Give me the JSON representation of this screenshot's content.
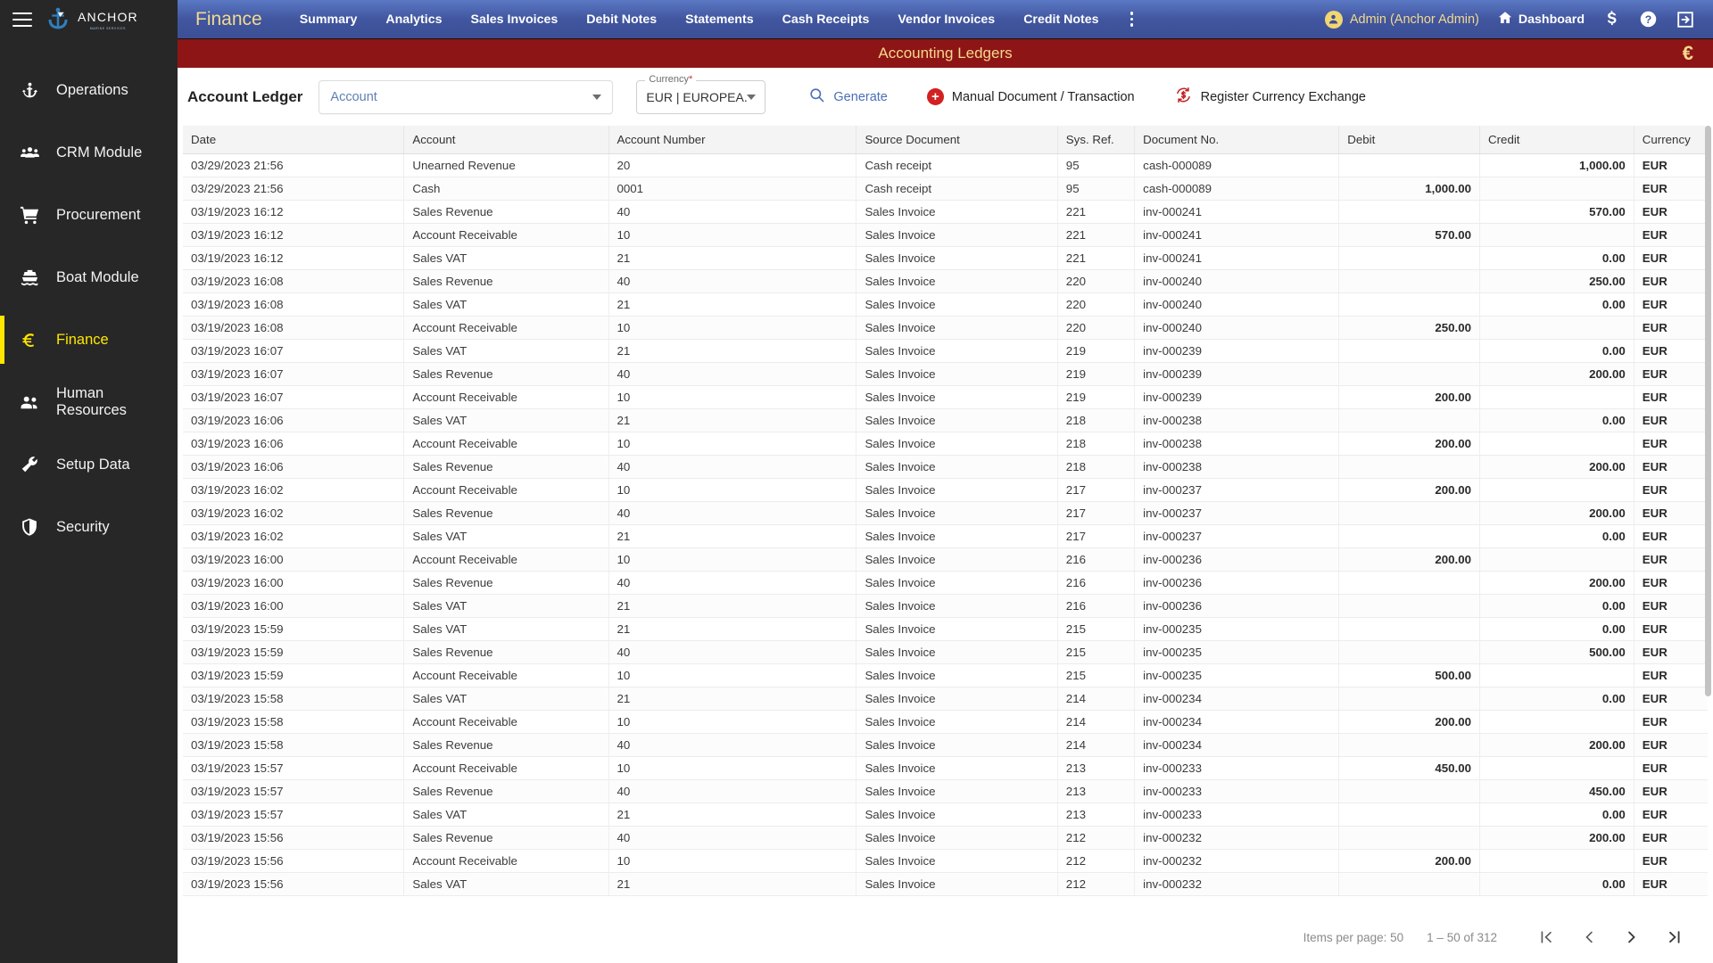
{
  "sidebar": {
    "logo": {
      "text": "ANCHOR",
      "sub": "MARINE SERVICES",
      "icon": "anchor-logo-icon"
    },
    "menu_icon": "hamburger-icon",
    "items": [
      {
        "label": "Operations",
        "icon": "anchor-icon",
        "active": false
      },
      {
        "label": "CRM Module",
        "icon": "people-icon",
        "active": false
      },
      {
        "label": "Procurement",
        "icon": "cart-icon",
        "active": false
      },
      {
        "label": "Boat Module",
        "icon": "boat-icon",
        "active": false
      },
      {
        "label": "Finance",
        "icon": "euro-icon",
        "active": true
      },
      {
        "label": "Human Resources",
        "icon": "group-icon",
        "active": false
      },
      {
        "label": "Setup Data",
        "icon": "wrench-icon",
        "active": false
      },
      {
        "label": "Security",
        "icon": "shield-icon",
        "active": false
      }
    ]
  },
  "topnav": {
    "brand": "Finance",
    "links": [
      "Summary",
      "Analytics",
      "Sales Invoices",
      "Debit Notes",
      "Statements",
      "Cash Receipts",
      "Vendor Invoices",
      "Credit Notes"
    ],
    "overflow_icon": "kebab-menu-icon",
    "user": "Admin (Anchor Admin)",
    "dashboard": "Dashboard",
    "icons": [
      "dollar-icon",
      "help-icon",
      "logout-icon"
    ]
  },
  "redbar": {
    "title": "Accounting Ledgers",
    "currency_symbol": "€"
  },
  "toolbar": {
    "panel_title": "Account Ledger",
    "account_select": {
      "placeholder": "Account",
      "value": "Account"
    },
    "currency_field": {
      "label": "Currency",
      "required": "*",
      "value": "EUR | EUROPEA..."
    },
    "generate_label": "Generate",
    "manual_label": "Manual Document / Transaction",
    "register_label": "Register Currency Exchange"
  },
  "table": {
    "columns": [
      "Date",
      "Account",
      "Account Number",
      "Source Document",
      "Sys. Ref.",
      "Document No.",
      "Debit",
      "Credit",
      "Currency"
    ],
    "rows": [
      [
        "03/29/2023 21:56",
        "Unearned Revenue",
        "20",
        "Cash receipt",
        "95",
        "cash-000089",
        "",
        "1,000.00",
        "EUR"
      ],
      [
        "03/29/2023 21:56",
        "Cash",
        "0001",
        "Cash receipt",
        "95",
        "cash-000089",
        "1,000.00",
        "",
        "EUR"
      ],
      [
        "03/19/2023 16:12",
        "Sales Revenue",
        "40",
        "Sales Invoice",
        "221",
        "inv-000241",
        "",
        "570.00",
        "EUR"
      ],
      [
        "03/19/2023 16:12",
        "Account Receivable",
        "10",
        "Sales Invoice",
        "221",
        "inv-000241",
        "570.00",
        "",
        "EUR"
      ],
      [
        "03/19/2023 16:12",
        "Sales VAT",
        "21",
        "Sales Invoice",
        "221",
        "inv-000241",
        "",
        "0.00",
        "EUR"
      ],
      [
        "03/19/2023 16:08",
        "Sales Revenue",
        "40",
        "Sales Invoice",
        "220",
        "inv-000240",
        "",
        "250.00",
        "EUR"
      ],
      [
        "03/19/2023 16:08",
        "Sales VAT",
        "21",
        "Sales Invoice",
        "220",
        "inv-000240",
        "",
        "0.00",
        "EUR"
      ],
      [
        "03/19/2023 16:08",
        "Account Receivable",
        "10",
        "Sales Invoice",
        "220",
        "inv-000240",
        "250.00",
        "",
        "EUR"
      ],
      [
        "03/19/2023 16:07",
        "Sales VAT",
        "21",
        "Sales Invoice",
        "219",
        "inv-000239",
        "",
        "0.00",
        "EUR"
      ],
      [
        "03/19/2023 16:07",
        "Sales Revenue",
        "40",
        "Sales Invoice",
        "219",
        "inv-000239",
        "",
        "200.00",
        "EUR"
      ],
      [
        "03/19/2023 16:07",
        "Account Receivable",
        "10",
        "Sales Invoice",
        "219",
        "inv-000239",
        "200.00",
        "",
        "EUR"
      ],
      [
        "03/19/2023 16:06",
        "Sales VAT",
        "21",
        "Sales Invoice",
        "218",
        "inv-000238",
        "",
        "0.00",
        "EUR"
      ],
      [
        "03/19/2023 16:06",
        "Account Receivable",
        "10",
        "Sales Invoice",
        "218",
        "inv-000238",
        "200.00",
        "",
        "EUR"
      ],
      [
        "03/19/2023 16:06",
        "Sales Revenue",
        "40",
        "Sales Invoice",
        "218",
        "inv-000238",
        "",
        "200.00",
        "EUR"
      ],
      [
        "03/19/2023 16:02",
        "Account Receivable",
        "10",
        "Sales Invoice",
        "217",
        "inv-000237",
        "200.00",
        "",
        "EUR"
      ],
      [
        "03/19/2023 16:02",
        "Sales Revenue",
        "40",
        "Sales Invoice",
        "217",
        "inv-000237",
        "",
        "200.00",
        "EUR"
      ],
      [
        "03/19/2023 16:02",
        "Sales VAT",
        "21",
        "Sales Invoice",
        "217",
        "inv-000237",
        "",
        "0.00",
        "EUR"
      ],
      [
        "03/19/2023 16:00",
        "Account Receivable",
        "10",
        "Sales Invoice",
        "216",
        "inv-000236",
        "200.00",
        "",
        "EUR"
      ],
      [
        "03/19/2023 16:00",
        "Sales Revenue",
        "40",
        "Sales Invoice",
        "216",
        "inv-000236",
        "",
        "200.00",
        "EUR"
      ],
      [
        "03/19/2023 16:00",
        "Sales VAT",
        "21",
        "Sales Invoice",
        "216",
        "inv-000236",
        "",
        "0.00",
        "EUR"
      ],
      [
        "03/19/2023 15:59",
        "Sales VAT",
        "21",
        "Sales Invoice",
        "215",
        "inv-000235",
        "",
        "0.00",
        "EUR"
      ],
      [
        "03/19/2023 15:59",
        "Sales Revenue",
        "40",
        "Sales Invoice",
        "215",
        "inv-000235",
        "",
        "500.00",
        "EUR"
      ],
      [
        "03/19/2023 15:59",
        "Account Receivable",
        "10",
        "Sales Invoice",
        "215",
        "inv-000235",
        "500.00",
        "",
        "EUR"
      ],
      [
        "03/19/2023 15:58",
        "Sales VAT",
        "21",
        "Sales Invoice",
        "214",
        "inv-000234",
        "",
        "0.00",
        "EUR"
      ],
      [
        "03/19/2023 15:58",
        "Account Receivable",
        "10",
        "Sales Invoice",
        "214",
        "inv-000234",
        "200.00",
        "",
        "EUR"
      ],
      [
        "03/19/2023 15:58",
        "Sales Revenue",
        "40",
        "Sales Invoice",
        "214",
        "inv-000234",
        "",
        "200.00",
        "EUR"
      ],
      [
        "03/19/2023 15:57",
        "Account Receivable",
        "10",
        "Sales Invoice",
        "213",
        "inv-000233",
        "450.00",
        "",
        "EUR"
      ],
      [
        "03/19/2023 15:57",
        "Sales Revenue",
        "40",
        "Sales Invoice",
        "213",
        "inv-000233",
        "",
        "450.00",
        "EUR"
      ],
      [
        "03/19/2023 15:57",
        "Sales VAT",
        "21",
        "Sales Invoice",
        "213",
        "inv-000233",
        "",
        "0.00",
        "EUR"
      ],
      [
        "03/19/2023 15:56",
        "Sales Revenue",
        "40",
        "Sales Invoice",
        "212",
        "inv-000232",
        "",
        "200.00",
        "EUR"
      ],
      [
        "03/19/2023 15:56",
        "Account Receivable",
        "10",
        "Sales Invoice",
        "212",
        "inv-000232",
        "200.00",
        "",
        "EUR"
      ],
      [
        "03/19/2023 15:56",
        "Sales VAT",
        "21",
        "Sales Invoice",
        "212",
        "inv-000232",
        "",
        "0.00",
        "EUR"
      ]
    ]
  },
  "paginator": {
    "items_per_page_label": "Items per page:",
    "items_per_page_value": "50",
    "range": "1 – 50 of 312",
    "buttons": [
      "first-page-icon",
      "previous-page-icon",
      "next-page-icon",
      "last-page-icon"
    ]
  },
  "colors": {
    "sidebar_bg": "#272727",
    "accent_yellow": "#ffe600",
    "nav_blue": "#41569f",
    "red_bar": "#8e1515",
    "brand_gold": "#f3d98e",
    "action_red": "#d32020",
    "link_blue": "#4a6fb5"
  }
}
